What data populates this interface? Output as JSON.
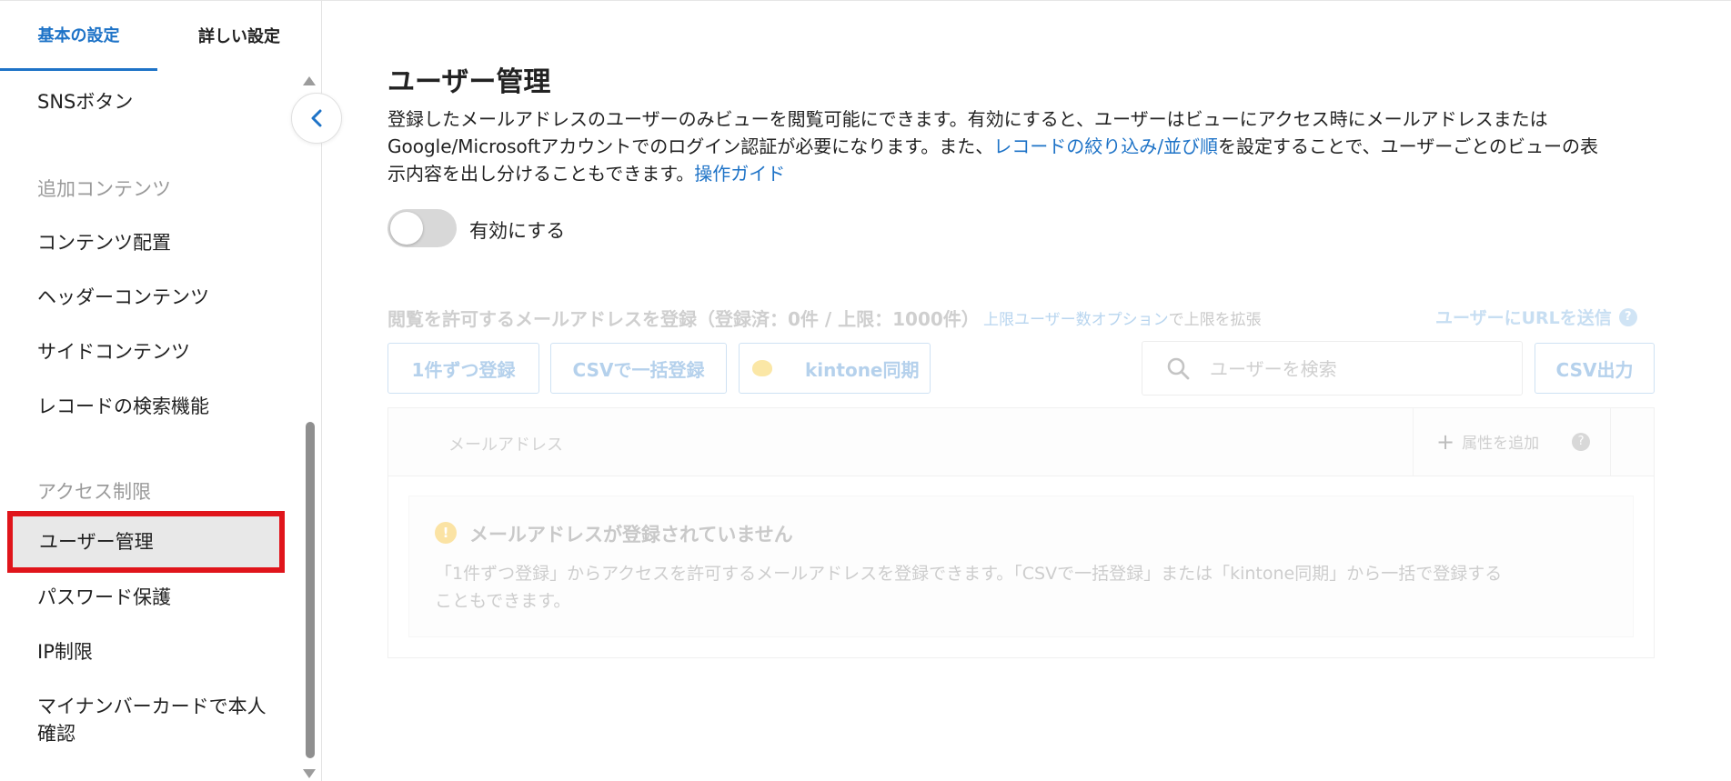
{
  "sidebar": {
    "tabs": [
      {
        "label": "基本の設定",
        "active": true
      },
      {
        "label": "詳しい設定",
        "active": false
      }
    ],
    "items": [
      {
        "label": "SNSボタン",
        "type": "item"
      },
      {
        "label": "追加コンテンツ",
        "type": "section"
      },
      {
        "label": "コンテンツ配置",
        "type": "item"
      },
      {
        "label": "ヘッダーコンテンツ",
        "type": "item"
      },
      {
        "label": "サイドコンテンツ",
        "type": "item"
      },
      {
        "label": "レコードの検索機能",
        "type": "item"
      },
      {
        "label": "アクセス制限",
        "type": "section"
      },
      {
        "label": "ユーザー管理",
        "type": "item",
        "selected": true
      },
      {
        "label": "パスワード保護",
        "type": "item"
      },
      {
        "label": "IP制限",
        "type": "item"
      },
      {
        "label": "マイナンバーカードで本人",
        "label_line2": "確認",
        "type": "item"
      }
    ]
  },
  "main": {
    "title": "ユーザー管理",
    "description": {
      "part1": "登録したメールアドレスのユーザーのみビューを閲覧可能にできます。有効にすると、ユーザーはビューにアクセス時にメールアドレスまたは",
      "part2": "Google/Microsoftアカウントでのログイン認証が必要になります。また、",
      "link1": "レコードの絞り込み/並び順",
      "part3": "を設定することで、ユーザーごとのビューの表",
      "part4": "示内容を出し分けることもできます。",
      "link2": "操作ガイド"
    },
    "toggle": {
      "label": "有効にする",
      "enabled": false
    },
    "registration": {
      "title": "閲覧を許可するメールアドレスを登録（登録済：0件 / 上限：1000件）",
      "option_link": "上限ユーザー数オプション",
      "option_suffix": "で上限を拡張",
      "send_url": "ユーザーにURLを送信",
      "buttons": {
        "single": "1件ずつ登録",
        "csv_bulk": "CSVで一括登録",
        "kintone": "kintone同期",
        "csv_export": "CSV出力"
      },
      "search_placeholder": "ユーザーを検索"
    },
    "table": {
      "col_email": "メールアドレス",
      "add_attribute": "属性を追加"
    },
    "empty": {
      "title": "メールアドレスが登録されていません",
      "text_line1": "「1件ずつ登録」からアクセスを許可するメールアドレスを登録できます。「CSVで一括登録」または「kintone同期」から一括で登録する",
      "text_line2": "こともできます。"
    }
  },
  "colors": {
    "accent": "#1e73c7",
    "highlight_border": "#e0151b",
    "selected_bg": "#e8e8e8"
  },
  "icons": {
    "collapse": "chevron-left-icon",
    "search": "search-icon",
    "warning": "warning-icon",
    "help": "question-icon",
    "add": "plus-icon",
    "kintone": "kintone-logo-icon"
  }
}
